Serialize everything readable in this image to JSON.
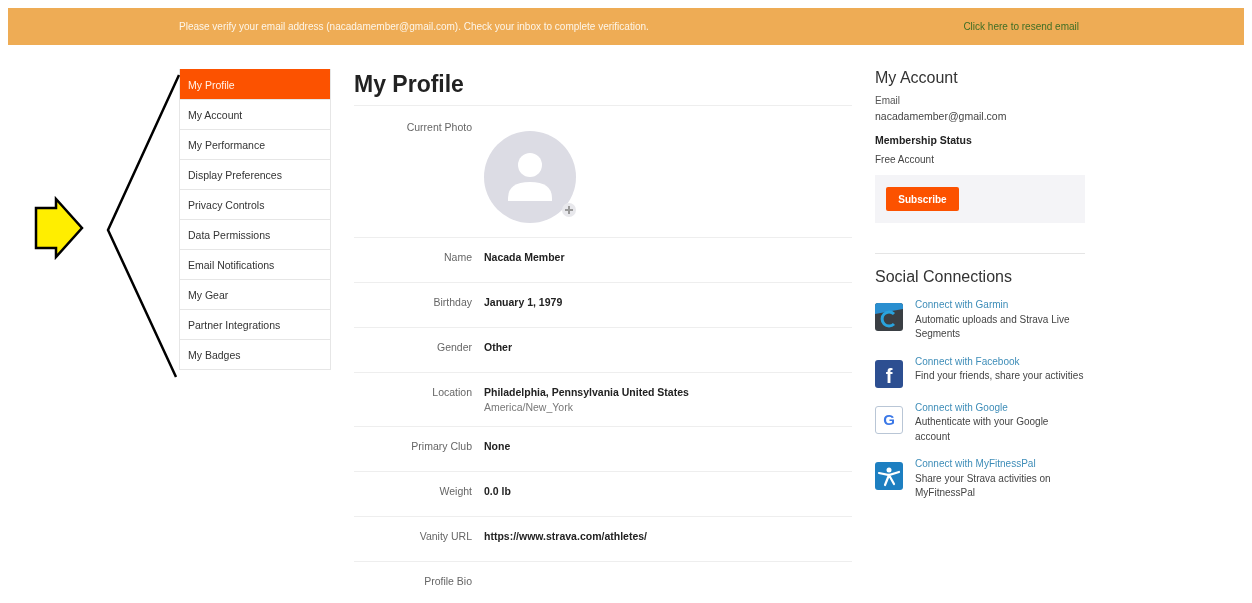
{
  "banner": {
    "message": "Please verify your email address (nacadamember@gmail.com). Check your inbox to complete verification.",
    "link": "Click here to resend email"
  },
  "sidebar": {
    "items": [
      {
        "label": "My Profile",
        "selected": true
      },
      {
        "label": "My Account",
        "selected": false
      },
      {
        "label": "My Performance",
        "selected": false
      },
      {
        "label": "Display Preferences",
        "selected": false
      },
      {
        "label": "Privacy Controls",
        "selected": false
      },
      {
        "label": "Data Permissions",
        "selected": false
      },
      {
        "label": "Email Notifications",
        "selected": false
      },
      {
        "label": "My Gear",
        "selected": false
      },
      {
        "label": "Partner Integrations",
        "selected": false
      },
      {
        "label": "My Badges",
        "selected": false
      }
    ]
  },
  "profile": {
    "title": "My Profile",
    "fields": [
      {
        "kind": "photo",
        "label": "Current Photo"
      },
      {
        "kind": "text",
        "label": "Name",
        "value": "Nacada Member"
      },
      {
        "kind": "text",
        "label": "Birthday",
        "value": "January 1, 1979"
      },
      {
        "kind": "text",
        "label": "Gender",
        "value": "Other"
      },
      {
        "kind": "text",
        "label": "Location",
        "value": "Philadelphia, Pennsylvania United States",
        "detail": "America/New_York"
      },
      {
        "kind": "text",
        "label": "Primary Club",
        "value": "None"
      },
      {
        "kind": "text",
        "label": "Weight",
        "value": "0.0 lb"
      },
      {
        "kind": "text",
        "label": "Vanity URL",
        "value": "https://www.strava.com/athletes/"
      },
      {
        "kind": "text",
        "label": "Profile Bio"
      }
    ]
  },
  "account": {
    "title": "My Account",
    "email_label": "Email",
    "email": "nacadamember@gmail.com",
    "status_label": "Membership Status",
    "status": "Free Account",
    "button": "Subscribe"
  },
  "social": {
    "title": "Social Connections",
    "items": [
      {
        "kind": "garmin",
        "link": "Connect with Garmin",
        "description": "Automatic uploads and Strava Live Segments"
      },
      {
        "kind": "facebook",
        "glyph": "f",
        "link": "Connect with Facebook",
        "description": "Find your friends, share your activities"
      },
      {
        "kind": "google",
        "glyph": "G",
        "link": "Connect with Google",
        "description": "Authenticate with your Google account"
      },
      {
        "kind": "myfitnesspal",
        "link": "Connect with MyFitnessPal",
        "description": "Share your Strava activities on MyFitnessPal"
      }
    ]
  }
}
